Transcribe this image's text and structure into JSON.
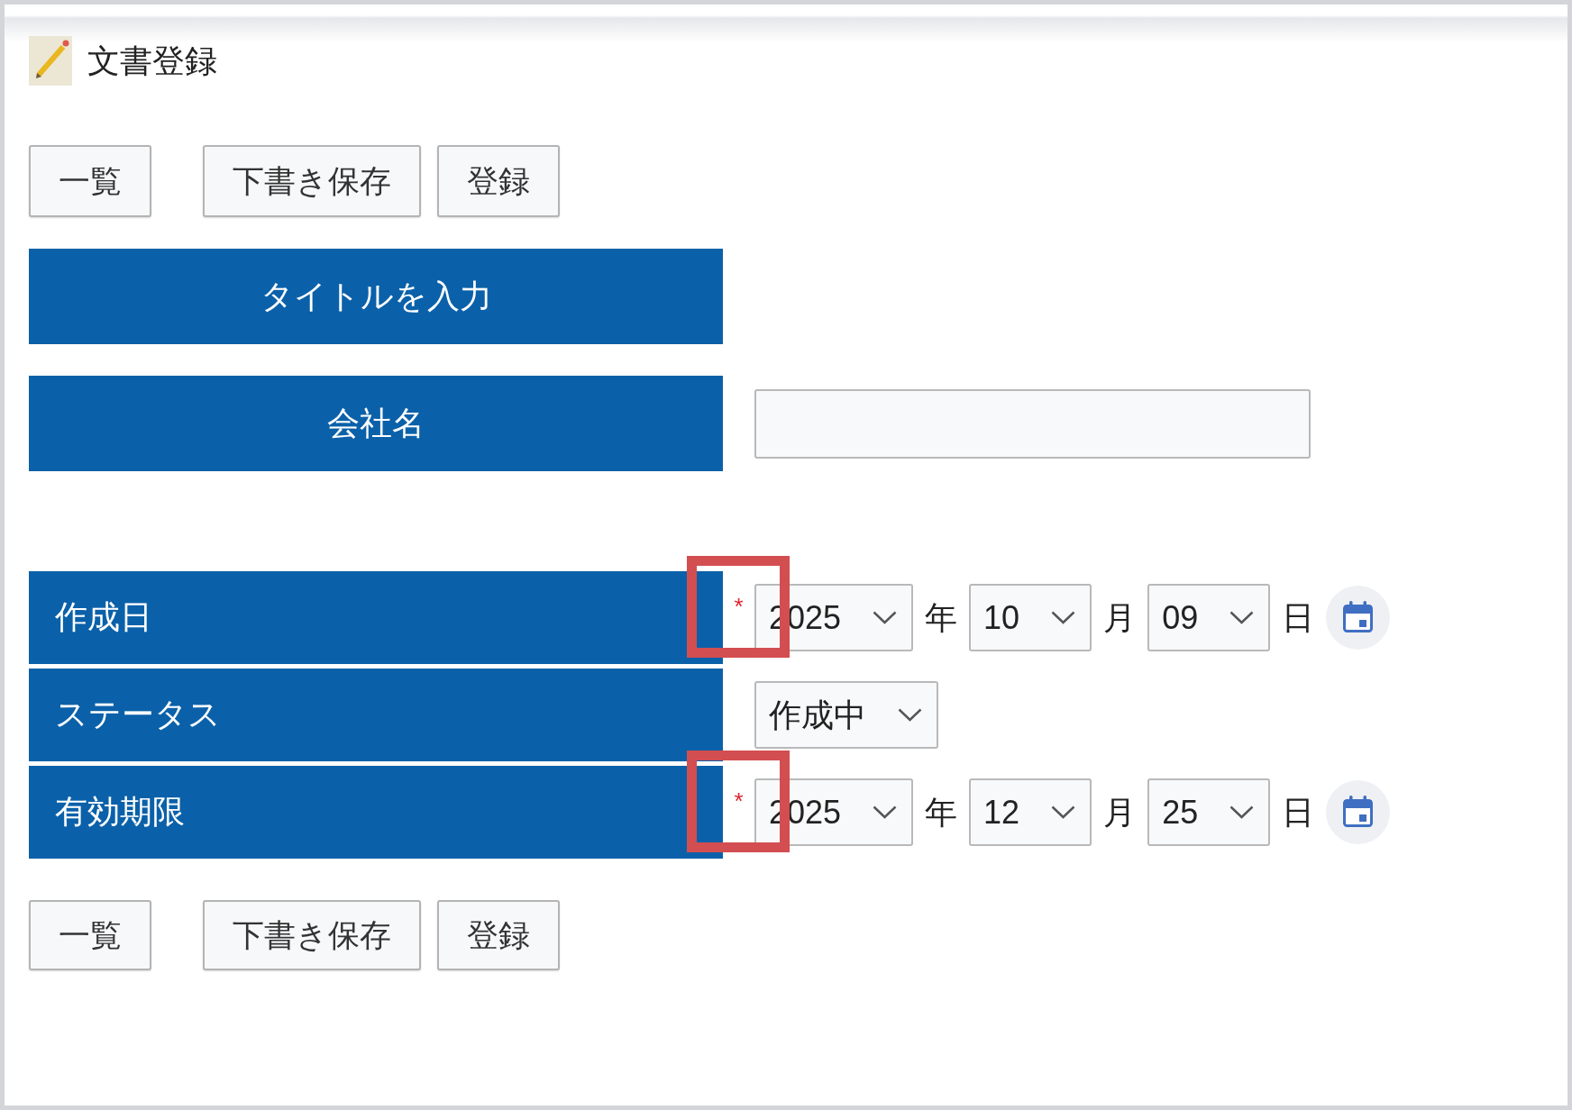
{
  "header": {
    "title": "文書登録"
  },
  "top_buttons": [
    {
      "label": "一覧"
    },
    {
      "label": "下書き保存"
    },
    {
      "label": "登録"
    }
  ],
  "upper_fields": [
    {
      "kind": "heading",
      "label": "タイトルを入力"
    },
    {
      "kind": "text",
      "label": "会社名"
    }
  ],
  "detail_fields": [
    {
      "kind": "date",
      "label": "作成日",
      "required_mark": "*",
      "highlighted": true,
      "parts": [
        {
          "value": "2025",
          "unit": "年"
        },
        {
          "value": "10",
          "unit": "月"
        },
        {
          "value": "09",
          "unit": "日"
        }
      ]
    },
    {
      "kind": "select",
      "label": "ステータス",
      "value": "作成中"
    },
    {
      "kind": "date",
      "label": "有効期限",
      "required_mark": "*",
      "highlighted": true,
      "parts": [
        {
          "value": "2025",
          "unit": "年"
        },
        {
          "value": "12",
          "unit": "月"
        },
        {
          "value": "25",
          "unit": "日"
        }
      ]
    }
  ],
  "bottom_buttons": [
    {
      "label": "一覧"
    },
    {
      "label": "下書き保存"
    },
    {
      "label": "登録"
    }
  ]
}
